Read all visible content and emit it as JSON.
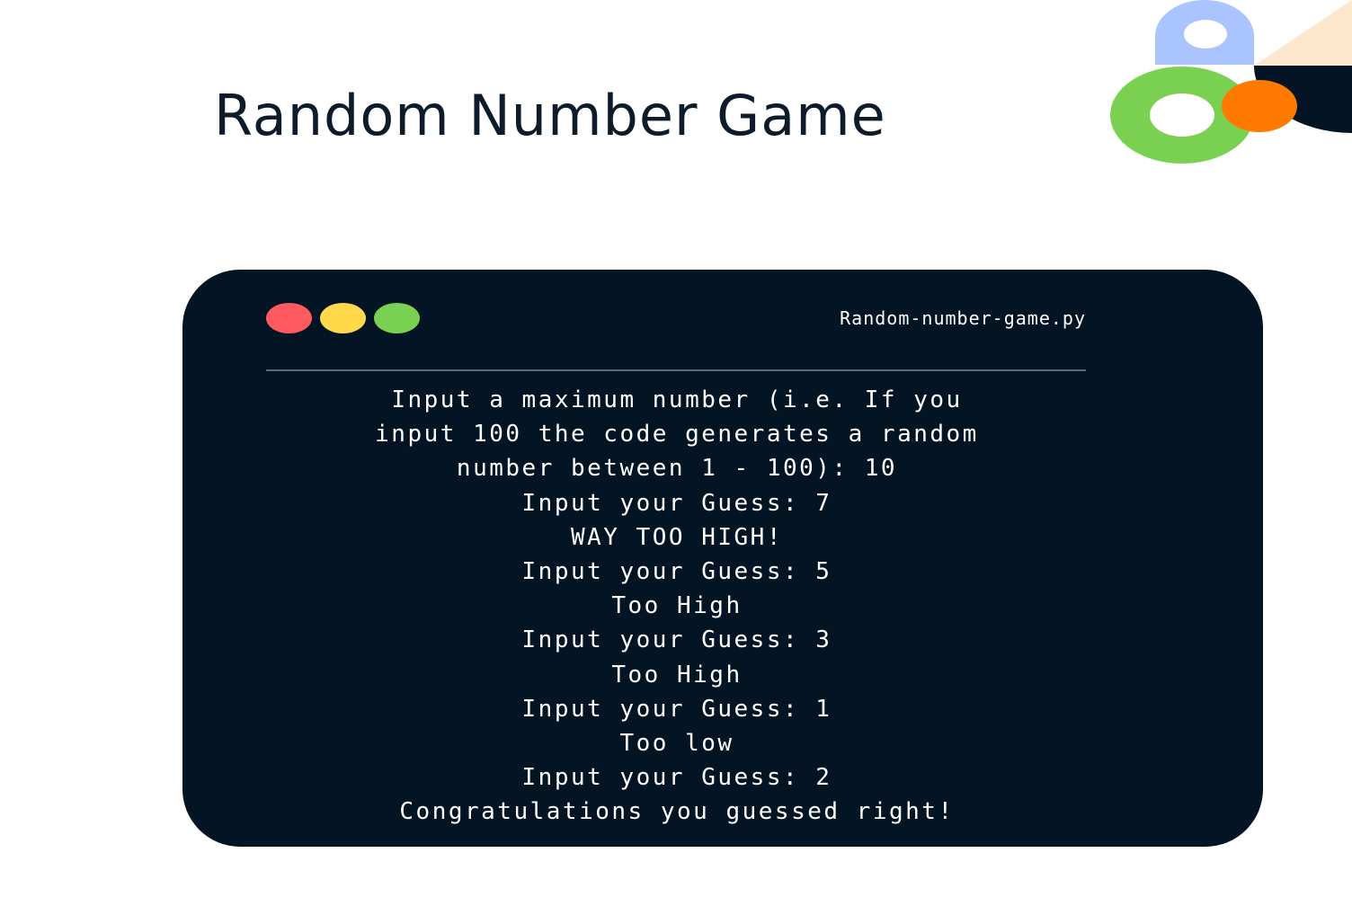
{
  "page": {
    "title": "Random Number Game"
  },
  "decoration": {
    "icons": [
      "blue-arch-icon",
      "green-ring-icon",
      "orange-circle-icon",
      "peach-triangle-icon",
      "navy-quarter-circle-icon"
    ],
    "colors": {
      "blue": "#a9c4ff",
      "green": "#7ad151",
      "orange": "#ff7a00",
      "peach": "#fde7cf",
      "navy": "#031524"
    }
  },
  "terminal": {
    "filename": "Random-number-game.py",
    "window_controls": [
      {
        "name": "close",
        "color": "#ff5a5f"
      },
      {
        "name": "minimize",
        "color": "#ffd94a"
      },
      {
        "name": "maximize",
        "color": "#7ad151"
      }
    ],
    "background_color": "#031524",
    "text_color": "#ffffff",
    "output_lines": [
      "Input a maximum number (i.e. If you",
      "input 100 the code generates a random",
      "number between 1 - 100): 10",
      "Input your Guess: 7",
      "WAY TOO HIGH!",
      "Input your Guess: 5",
      "Too High",
      "Input your Guess: 3",
      "Too High",
      "Input your Guess: 1",
      "Too low",
      "Input your Guess: 2",
      "Congratulations you guessed right!"
    ]
  }
}
